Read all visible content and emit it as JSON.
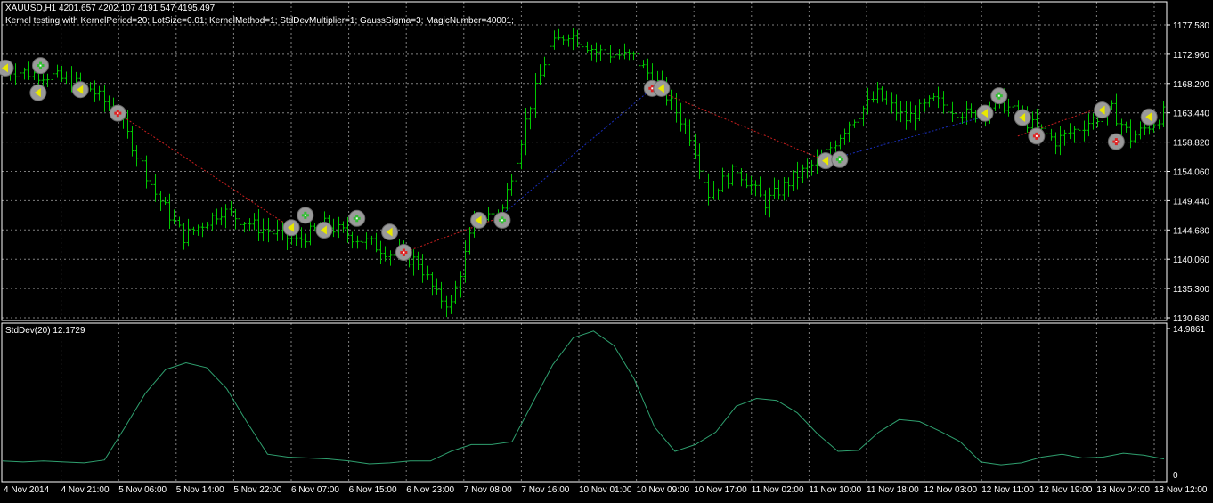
{
  "window": {
    "header": "XAUUSD,H1  4201.657 4202.107 4191.547 4195.497",
    "subheader": "Kernel testing with KernelPeriod=20; LotSize=0.01; KernelMethod=1; StdDevMultiplier=1; GaussSigma=3; MagicNumber=40001;"
  },
  "colors": {
    "background": "#000000",
    "grid": "#7f7f7f",
    "bar": "#00c800",
    "stddev": "#2fa06f",
    "trade_up": "#1a2fbf",
    "trade_down": "#c81e1e",
    "marker_bg": "#9a9a9a",
    "marker_arrow": "#e8e800",
    "buy_cross": "#2fbf2f",
    "sell_cross": "#e02020"
  },
  "chart_data": [
    {
      "type": "ohlc",
      "title": "XAUUSD,H1",
      "y_ticks": [
        "1177.580",
        "1172.960",
        "1168.200",
        "1163.440",
        "1158.820",
        "1154.060",
        "1149.440",
        "1144.680",
        "1140.060",
        "1135.300",
        "1130.680"
      ],
      "ylim": [
        1130.0,
        1181.5
      ],
      "grid": true,
      "x_ticks": [
        "4 Nov 2014",
        "4 Nov 21:00",
        "5 Nov 06:00",
        "5 Nov 14:00",
        "5 Nov 22:00",
        "6 Nov 07:00",
        "6 Nov 15:00",
        "6 Nov 23:00",
        "7 Nov 08:00",
        "7 Nov 16:00",
        "10 Nov 01:00",
        "10 Nov 09:00",
        "10 Nov 17:00",
        "11 Nov 02:00",
        "11 Nov 10:00",
        "11 Nov 18:00",
        "12 Nov 03:00",
        "12 Nov 11:00",
        "12 Nov 19:00",
        "13 Nov 04:00",
        "13 Nov 12:00"
      ],
      "anchors": [
        {
          "bar": 0,
          "price": 1170.5
        },
        {
          "bar": 10,
          "price": 1169.5
        },
        {
          "bar": 18,
          "price": 1167.5
        },
        {
          "bar": 24,
          "price": 1163.2
        },
        {
          "bar": 32,
          "price": 1150.5
        },
        {
          "bar": 38,
          "price": 1143.5
        },
        {
          "bar": 46,
          "price": 1147.8
        },
        {
          "bar": 54,
          "price": 1145.0
        },
        {
          "bar": 62,
          "price": 1142.8
        },
        {
          "bar": 68,
          "price": 1145.5
        },
        {
          "bar": 76,
          "price": 1143.0
        },
        {
          "bar": 82,
          "price": 1141.0
        },
        {
          "bar": 88,
          "price": 1139.5
        },
        {
          "bar": 92,
          "price": 1134.0
        },
        {
          "bar": 95,
          "price": 1132.5
        },
        {
          "bar": 100,
          "price": 1146.0
        },
        {
          "bar": 106,
          "price": 1148.0
        },
        {
          "bar": 112,
          "price": 1165.0
        },
        {
          "bar": 116,
          "price": 1174.0
        },
        {
          "bar": 120,
          "price": 1176.5
        },
        {
          "bar": 126,
          "price": 1173.5
        },
        {
          "bar": 134,
          "price": 1172.5
        },
        {
          "bar": 140,
          "price": 1167.5
        },
        {
          "bar": 146,
          "price": 1160.0
        },
        {
          "bar": 150,
          "price": 1150.5
        },
        {
          "bar": 156,
          "price": 1154.5
        },
        {
          "bar": 162,
          "price": 1149.0
        },
        {
          "bar": 168,
          "price": 1153.0
        },
        {
          "bar": 174,
          "price": 1156.0
        },
        {
          "bar": 180,
          "price": 1162.0
        },
        {
          "bar": 186,
          "price": 1166.5
        },
        {
          "bar": 192,
          "price": 1162.5
        },
        {
          "bar": 198,
          "price": 1165.5
        },
        {
          "bar": 206,
          "price": 1163.0
        },
        {
          "bar": 212,
          "price": 1165.5
        },
        {
          "bar": 218,
          "price": 1162.0
        },
        {
          "bar": 224,
          "price": 1159.0
        },
        {
          "bar": 232,
          "price": 1162.5
        },
        {
          "bar": 236,
          "price": 1164.0
        },
        {
          "bar": 240,
          "price": 1159.5
        },
        {
          "bar": 244,
          "price": 1161.5
        },
        {
          "bar": 247,
          "price": 1163.5
        }
      ],
      "trades": [
        {
          "from_bar": 24,
          "from_price": 1163.5,
          "to_bar": 61,
          "to_price": 1145.0,
          "result": "down"
        },
        {
          "from_bar": 85,
          "from_price": 1141.0,
          "to_bar": 105,
          "to_price": 1146.5,
          "result": "down"
        },
        {
          "from_bar": 105,
          "from_price": 1146.5,
          "to_bar": 138,
          "to_price": 1167.5,
          "result": "up"
        },
        {
          "from_bar": 138,
          "from_price": 1167.5,
          "to_bar": 175,
          "to_price": 1155.8,
          "result": "down"
        },
        {
          "from_bar": 175,
          "from_price": 1155.8,
          "to_bar": 209,
          "to_price": 1163.0,
          "result": "up"
        },
        {
          "from_bar": 216,
          "from_price": 1159.8,
          "to_bar": 232,
          "to_price": 1164.0,
          "result": "down"
        }
      ],
      "markers": [
        {
          "bar": 0,
          "price": 1170.8,
          "kind": "exit"
        },
        {
          "bar": 7,
          "price": 1166.8,
          "kind": "exit"
        },
        {
          "bar": 7.5,
          "price": 1171.2,
          "kind": "buy"
        },
        {
          "bar": 16,
          "price": 1167.3,
          "kind": "exit"
        },
        {
          "bar": 24,
          "price": 1163.5,
          "kind": "sell"
        },
        {
          "bar": 61,
          "price": 1145.0,
          "kind": "exit"
        },
        {
          "bar": 64,
          "price": 1147.0,
          "kind": "buy"
        },
        {
          "bar": 68,
          "price": 1144.6,
          "kind": "exit"
        },
        {
          "bar": 75,
          "price": 1146.5,
          "kind": "buy"
        },
        {
          "bar": 82,
          "price": 1144.3,
          "kind": "exit"
        },
        {
          "bar": 85,
          "price": 1141.0,
          "kind": "sell"
        },
        {
          "bar": 101,
          "price": 1146.2,
          "kind": "exit"
        },
        {
          "bar": 106,
          "price": 1146.2,
          "kind": "buy"
        },
        {
          "bar": 138,
          "price": 1167.5,
          "kind": "sell"
        },
        {
          "bar": 140,
          "price": 1167.5,
          "kind": "exit"
        },
        {
          "bar": 175,
          "price": 1155.8,
          "kind": "exit"
        },
        {
          "bar": 178,
          "price": 1156.0,
          "kind": "buy"
        },
        {
          "bar": 209,
          "price": 1163.5,
          "kind": "exit"
        },
        {
          "bar": 212,
          "price": 1166.3,
          "kind": "buy"
        },
        {
          "bar": 217,
          "price": 1162.8,
          "kind": "exit"
        },
        {
          "bar": 220,
          "price": 1159.8,
          "kind": "sell"
        },
        {
          "bar": 234,
          "price": 1164.0,
          "kind": "exit"
        },
        {
          "bar": 237,
          "price": 1158.9,
          "kind": "sell"
        },
        {
          "bar": 244,
          "price": 1162.9,
          "kind": "exit"
        }
      ]
    },
    {
      "type": "line",
      "title": "StdDev(20) 12.1729",
      "y_ticks": [
        "14.9861",
        "0"
      ],
      "ylim": [
        0,
        14.9861
      ],
      "series": [
        {
          "name": "StdDev(20)",
          "values": [
            1.5,
            1.4,
            1.5,
            1.4,
            1.3,
            1.6,
            5,
            8.5,
            11,
            11.7,
            11.2,
            9,
            5.5,
            2.2,
            1.9,
            1.8,
            1.7,
            1.5,
            1.2,
            1.3,
            1.5,
            1.5,
            2.5,
            3.2,
            3.2,
            3.5,
            7.5,
            11.5,
            14.3,
            15,
            13.5,
            10,
            5,
            2.5,
            3.2,
            4.5,
            7.2,
            8,
            7.8,
            6.5,
            4.3,
            2.5,
            2.6,
            4.5,
            5.8,
            5.6,
            4.6,
            3.5,
            1.4,
            1.1,
            1.3,
            1.9,
            2.2,
            1.8,
            1.9,
            2.3,
            2.1,
            1.7
          ]
        }
      ]
    }
  ]
}
